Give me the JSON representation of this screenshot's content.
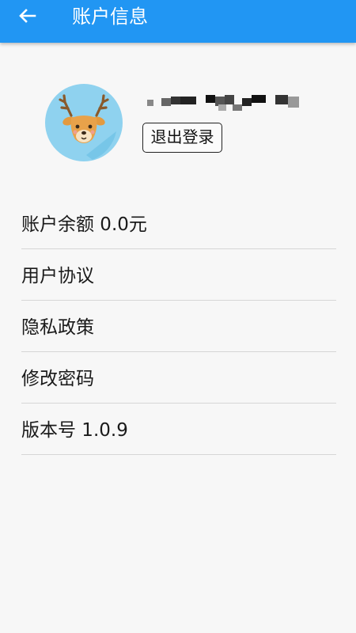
{
  "header": {
    "back_icon": "arrow-left-icon",
    "title": "账户信息"
  },
  "profile": {
    "avatar_icon": "deer-avatar-icon",
    "username_masked": true,
    "logout_label": "退出登录"
  },
  "menu": {
    "items": [
      {
        "id": "balance",
        "label": "账户余额 0.0元"
      },
      {
        "id": "user-agreement",
        "label": "用户协议"
      },
      {
        "id": "privacy-policy",
        "label": "隐私政策"
      },
      {
        "id": "change-password",
        "label": "修改密码"
      },
      {
        "id": "version",
        "label": "版本号 1.0.9"
      }
    ]
  },
  "colors": {
    "header_bg": "#2196f3",
    "page_bg": "#f7f7f7",
    "avatar_bg": "#8fd2ef",
    "divider": "#d6d6d6"
  }
}
